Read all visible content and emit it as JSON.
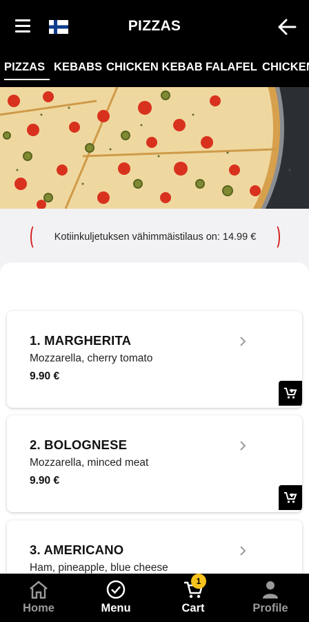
{
  "header": {
    "title": "PIZZAS",
    "flag": "finland-flag",
    "menu_icon": "hamburger-menu-icon",
    "back_icon": "arrow-left-icon"
  },
  "tabs": [
    {
      "label": "PIZZAS",
      "active": true
    },
    {
      "label": "KEBABS"
    },
    {
      "label": "CHICKEN KEBAB"
    },
    {
      "label": "FALAFEL"
    },
    {
      "label": "CHICKEN"
    }
  ],
  "notice": {
    "text": "Kotiinkuljetuksen vähimmäistilaus on: 14.99 €"
  },
  "products": [
    {
      "title": "1. MARGHERITA",
      "description": "Mozzarella, cherry tomato",
      "price": "9.90 €"
    },
    {
      "title": "2. BOLOGNESE",
      "description": "Mozzarella, minced meat",
      "price": "9.90 €"
    },
    {
      "title": "3. AMERICANO",
      "description": "Ham, pineapple, blue cheese",
      "price": ""
    }
  ],
  "bottom_nav": {
    "items": [
      {
        "label": "Home",
        "icon": "home-icon",
        "active": false
      },
      {
        "label": "Menu",
        "icon": "check-circle-icon",
        "active": true
      },
      {
        "label": "Cart",
        "icon": "cart-icon",
        "active": true
      },
      {
        "label": "Profile",
        "icon": "person-icon",
        "active": false
      }
    ],
    "cart_badge": "1"
  },
  "colors": {
    "header_bg": "#000000",
    "accent_red": "#d61f1f",
    "badge_yellow": "#f6c21b",
    "inactive_nav": "#9a9a9a"
  }
}
